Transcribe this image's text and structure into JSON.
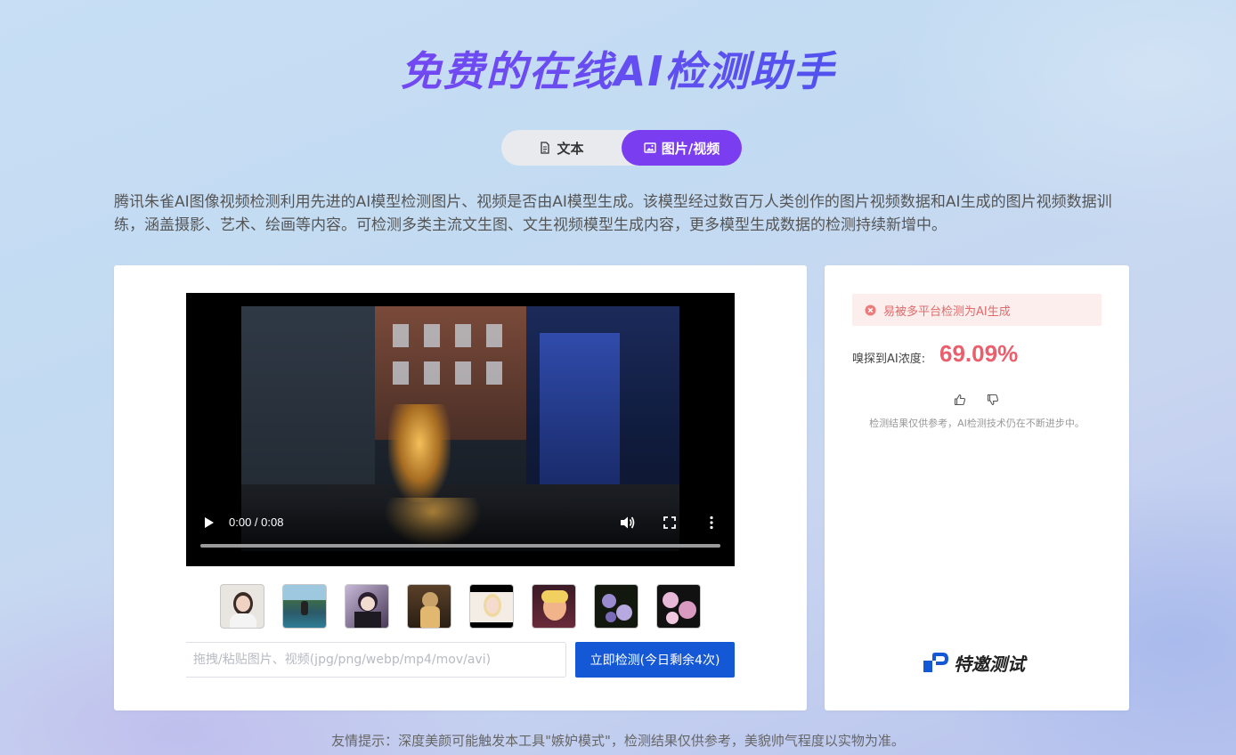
{
  "page": {
    "title": "免费的在线AI检测助手"
  },
  "tabs": [
    {
      "label": "文本",
      "icon": "document-icon",
      "active": false
    },
    {
      "label": "图片/视频",
      "icon": "image-icon",
      "active": true
    }
  ],
  "description": "腾讯朱雀AI图像视频检测利用先进的AI模型检测图片、视频是否由AI模型生成。该模型经过数百万人类创作的图片视频数据和AI生成的图片视频数据训练，涵盖摄影、艺术、绘画等内容。可检测多类主流文生图、文生视频模型生成内容，更多模型生成数据的检测持续新增中。",
  "player": {
    "time": "0:00 / 0:08",
    "controls": [
      "play-icon",
      "volume-icon",
      "fullscreen-icon",
      "more-options-icon"
    ],
    "progress": 0
  },
  "samples": [
    {
      "name": "sample-portrait-woman"
    },
    {
      "name": "sample-lake-scene"
    },
    {
      "name": "sample-anime-character"
    },
    {
      "name": "sample-fantasy-figure"
    },
    {
      "name": "sample-blonde-portrait"
    },
    {
      "name": "sample-pink-portrait"
    },
    {
      "name": "sample-flowers-dark"
    },
    {
      "name": "sample-pink-blossoms"
    }
  ],
  "upload": {
    "placeholder": "拖拽/粘贴图片、视频(jpg/png/webp/mp4/mov/avi)",
    "value": "",
    "button_label": "立即检测(今日剩余4次)"
  },
  "result": {
    "alert": "易被多平台检测为AI生成",
    "concentration_label": "嗅探到AI浓度:",
    "concentration_value": "69.09%",
    "note": "检测结果仅供参考，AI检测技术仍在不断进步中。",
    "invite_label": "特邀测试"
  },
  "footer": {
    "tip": "友情提示：深度美颜可能触发本工具\"嫉妒模式\"，检测结果仅供参考，美貌帅气程度以实物为准。"
  },
  "colors": {
    "accent_purple": "#7b3df0",
    "primary_blue": "#1558d6",
    "alert_red": "#e06a6a",
    "value_red": "#ea5f6b"
  }
}
